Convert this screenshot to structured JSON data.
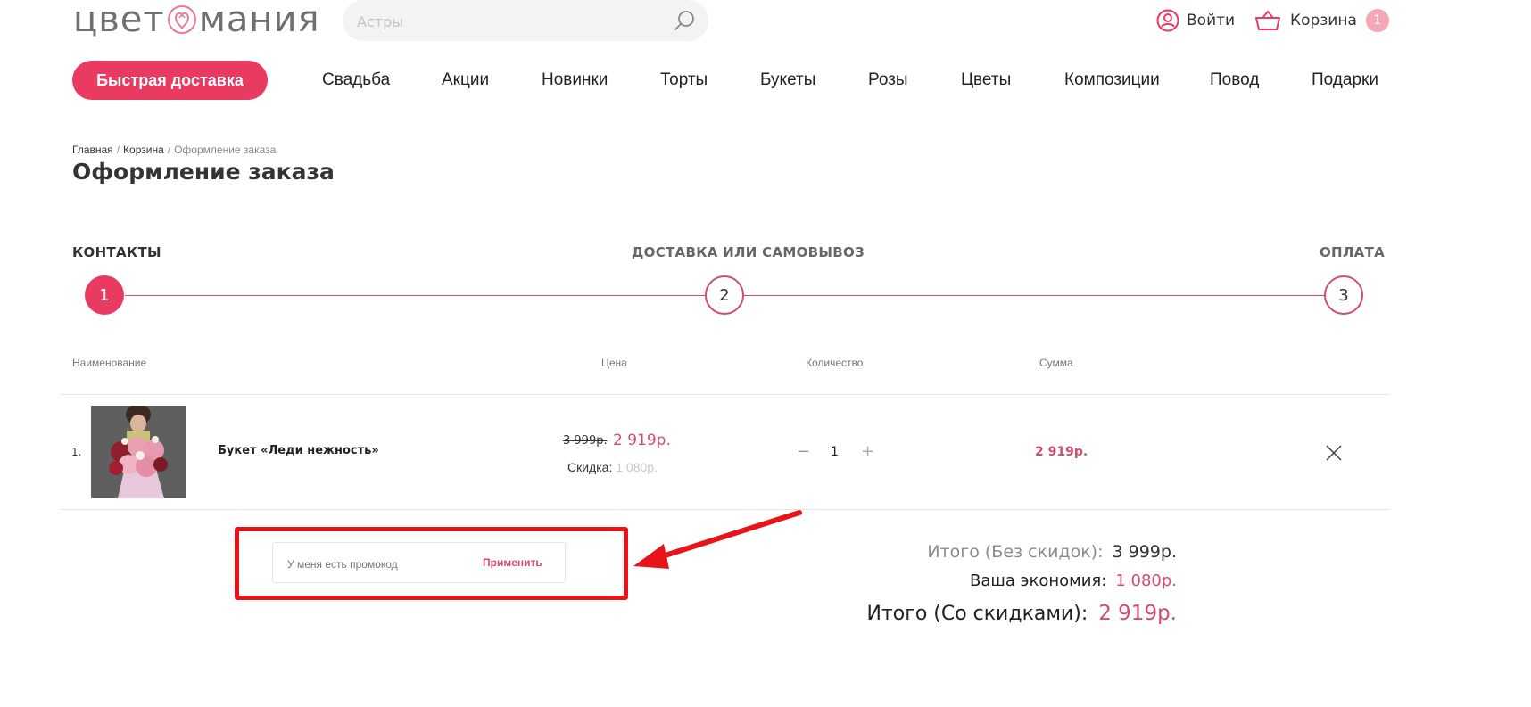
{
  "header": {
    "logo_left": "цвет",
    "logo_right": "мания",
    "search_placeholder": "Астры",
    "login_label": "Войти",
    "cart_label": "Корзина",
    "cart_count": "1"
  },
  "nav": {
    "fast_delivery": "Быстрая доставка",
    "items": [
      "Свадьба",
      "Акции",
      "Новинки",
      "Торты",
      "Букеты",
      "Розы",
      "Цветы",
      "Композиции",
      "Повод",
      "Подарки"
    ]
  },
  "breadcrumb": {
    "items": [
      "Главная",
      "Корзина"
    ],
    "separator": "/",
    "current": "Оформление заказа"
  },
  "page_title": "Оформление заказа",
  "steps": [
    {
      "label": "КОНТАКТЫ",
      "number": "1"
    },
    {
      "label": "ДОСТАВКА ИЛИ САМОВЫВОЗ",
      "number": "2"
    },
    {
      "label": "ОПЛАТА",
      "number": "3"
    }
  ],
  "table": {
    "headers": {
      "name": "Наименование",
      "price": "Цена",
      "qty": "Количество",
      "sum": "Сумма"
    },
    "rows": [
      {
        "index": "1.",
        "name": "Букет «Леди нежность»",
        "old_price": "3 999р.",
        "price": "2 919р.",
        "discount_label": "Скидка:",
        "discount_value": "1 080р.",
        "qty_minus": "−",
        "qty": "1",
        "qty_plus": "+",
        "sum": "2 919р."
      }
    ]
  },
  "promo": {
    "placeholder": "У меня есть промокод",
    "apply_label": "Применить"
  },
  "totals": {
    "no_discount_label": "Итого (Без скидок):",
    "no_discount_value": "3 999р.",
    "savings_label": "Ваша экономия:",
    "savings_value": "1 080р.",
    "with_discount_label": "Итого (Со скидками):",
    "with_discount_value": "2 919р."
  },
  "colors": {
    "accent": "#e93b62",
    "price": "#d24d6c",
    "highlight_box": "#e8141a"
  }
}
